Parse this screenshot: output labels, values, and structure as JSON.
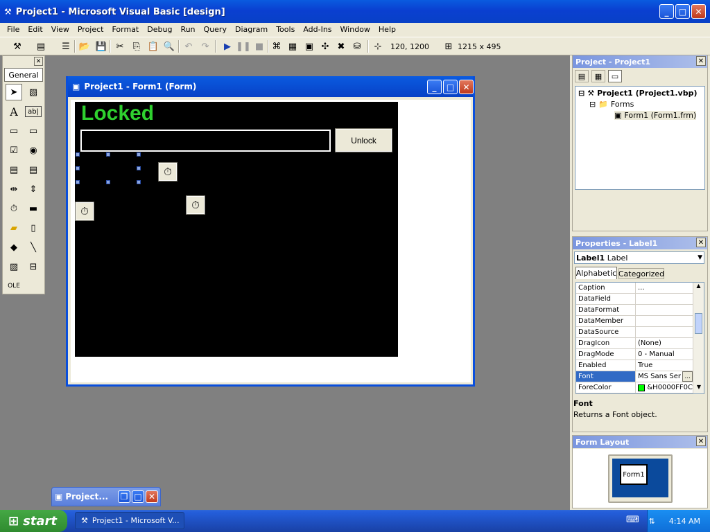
{
  "window": {
    "title": "Project1 - Microsoft Visual Basic [design]"
  },
  "menu": [
    "File",
    "Edit",
    "View",
    "Project",
    "Format",
    "Debug",
    "Run",
    "Query",
    "Diagram",
    "Tools",
    "Add-Ins",
    "Window",
    "Help"
  ],
  "toolbar": {
    "position": "120, 1200",
    "size": "1215 x 495"
  },
  "toolbox": {
    "tab": "General"
  },
  "form_window": {
    "title": "Project1 - Form1 (Form)",
    "label_caption": "Locked",
    "button_caption": "Unlock",
    "accent_color": "#2fd12f"
  },
  "project_panel": {
    "title": "Project - Project1",
    "root": "Project1 (Project1.vbp)",
    "folder": "Forms",
    "item": "Form1 (Form1.frm)"
  },
  "properties_panel": {
    "title": "Properties - Label1",
    "object_name": "Label1",
    "object_type": "Label",
    "tabs": [
      "Alphabetic",
      "Categorized"
    ],
    "rows": [
      {
        "name": "Caption",
        "value": "..."
      },
      {
        "name": "DataField",
        "value": ""
      },
      {
        "name": "DataFormat",
        "value": ""
      },
      {
        "name": "DataMember",
        "value": ""
      },
      {
        "name": "DataSource",
        "value": ""
      },
      {
        "name": "DragIcon",
        "value": "(None)"
      },
      {
        "name": "DragMode",
        "value": "0 - Manual"
      },
      {
        "name": "Enabled",
        "value": "True"
      },
      {
        "name": "Font",
        "value": "MS Sans Ser"
      },
      {
        "name": "ForeColor",
        "value": "&H0000FF0C"
      }
    ],
    "desc_title": "Font",
    "desc_text": "Returns a Font object."
  },
  "layout_panel": {
    "title": "Form Layout",
    "form_label": "Form1"
  },
  "minimized": {
    "title": "Project..."
  },
  "taskbar": {
    "start": "start",
    "item": "Project1 - Microsoft V...",
    "clock": "4:14 AM"
  }
}
